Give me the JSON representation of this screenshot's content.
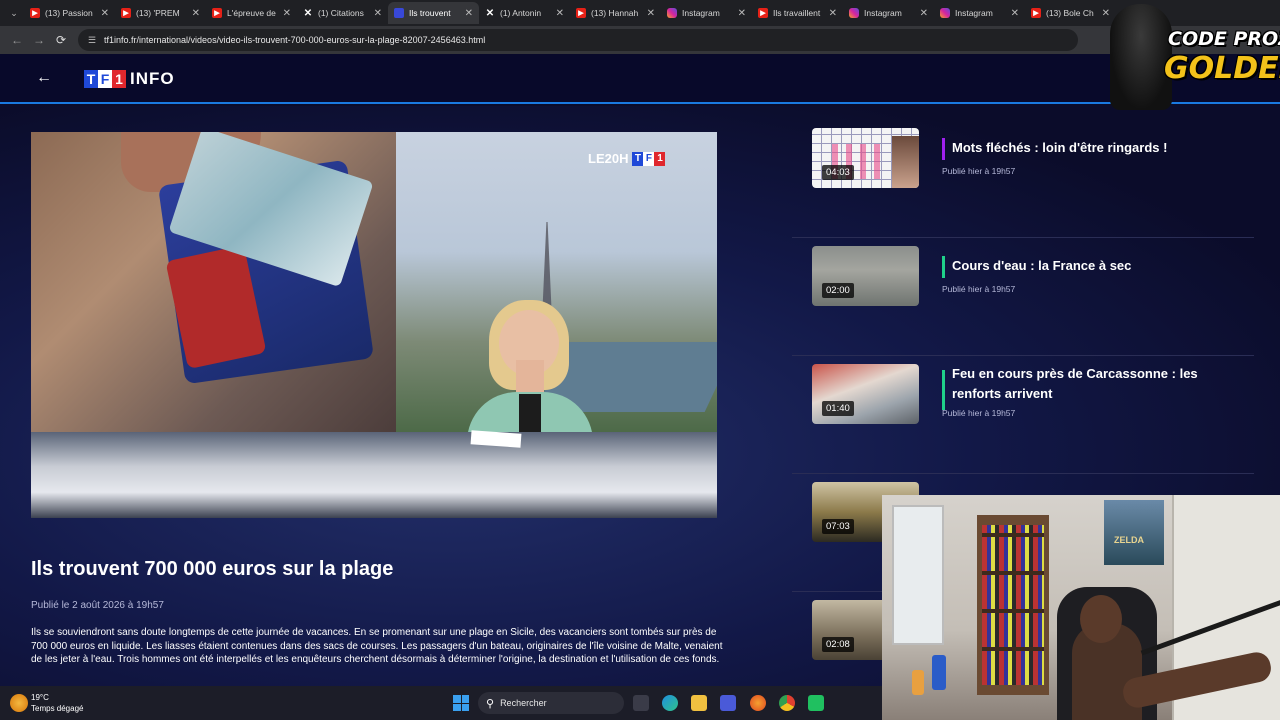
{
  "browser": {
    "tabs": [
      {
        "label": "(13) Passion",
        "icon": "youtube-icon",
        "active": false
      },
      {
        "label": "(13) 'PREM",
        "icon": "youtube-icon",
        "active": false
      },
      {
        "label": "L'épreuve de",
        "icon": "youtube-icon",
        "active": false
      },
      {
        "label": "(1) Citations",
        "icon": "x-icon",
        "active": false
      },
      {
        "label": "Ils trouvent",
        "icon": "tf1-icon",
        "active": true
      },
      {
        "label": "(1) Antonin",
        "icon": "x-icon",
        "active": false
      },
      {
        "label": "(13) Hannah",
        "icon": "youtube-icon",
        "active": false
      },
      {
        "label": "Instagram",
        "icon": "instagram-icon",
        "active": false
      },
      {
        "label": "Ils travaillent",
        "icon": "youtube-icon",
        "active": false
      },
      {
        "label": "Instagram",
        "icon": "instagram-icon",
        "active": false
      },
      {
        "label": "Instagram",
        "icon": "instagram-icon",
        "active": false
      },
      {
        "label": "(13) Bole Ch",
        "icon": "youtube-icon",
        "active": false
      }
    ],
    "url": "tf1info.fr/international/videos/video-ils-trouvent-700-000-euros-sur-la-plage-82007-2456463.html"
  },
  "site": {
    "logo_tf": [
      "T",
      "F",
      "1"
    ],
    "logo_info": "INFO"
  },
  "video": {
    "badge_text": "LE20H",
    "badge_tf": [
      "T",
      "F",
      "1"
    ]
  },
  "article": {
    "title": "Ils trouvent 700 000 euros sur la plage",
    "published": "Publié le 2 août 2026 à 19h57",
    "summary": "Ils se souviendront sans doute longtemps de cette journée de vacances. En se promenant sur une plage en Sicile, des vacanciers sont tombés sur près de 700 000 euros en liquide. Les liasses étaient contenues dans des sacs de courses. Les passagers d'un bateau, originaires de l'île voisine de Malte, venaient de les jeter à l'eau. Trois hommes ont été interpellés et les enquêteurs cherchent désormais à déterminer l'origine, la destination et l'utilisation de ces fonds."
  },
  "related": [
    {
      "title": "Mots fléchés : loin d'être ringards !",
      "date": "Publié hier à 19h57",
      "duration": "04:03",
      "accent": "#a020f0"
    },
    {
      "title": "Cours d'eau : la France à sec",
      "date": "Publié hier à 19h57",
      "duration": "02:00",
      "accent": "#1fd18a"
    },
    {
      "title": "Feu en cours près de Carcassonne : les renforts arrivent",
      "date": "Publié hier à 19h57",
      "duration": "01:40",
      "accent": "#1fd18a"
    },
    {
      "title": "",
      "date": "",
      "duration": "07:03",
      "accent": "#1fd18a"
    },
    {
      "title": "",
      "date": "",
      "duration": "02:08",
      "accent": "#1fd18a"
    }
  ],
  "webcam": {
    "poster_text": "ZELDA"
  },
  "streamer_logo": {
    "line1": "CODE PROZIS",
    "line2": "GOLDENG"
  },
  "taskbar": {
    "temperature": "19°C",
    "weather": "Temps dégagé",
    "search_label": "Rechercher"
  }
}
